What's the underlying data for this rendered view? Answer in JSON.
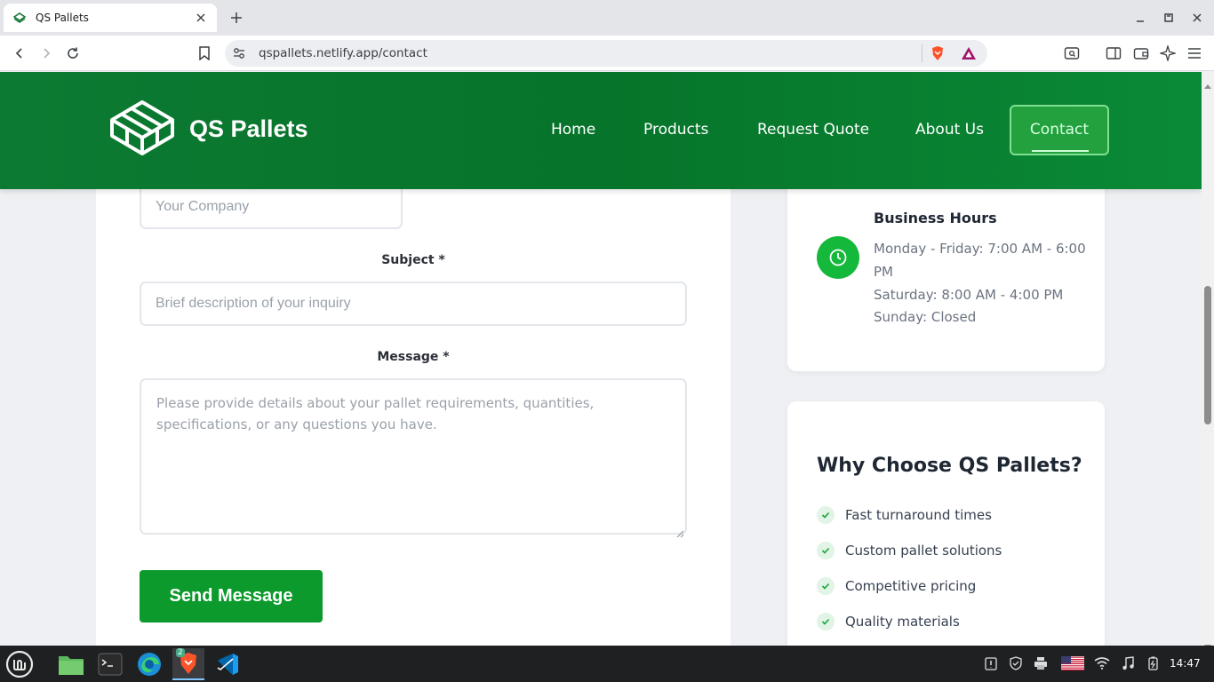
{
  "browser": {
    "tab_title": "QS Pallets",
    "url": "qspallets.netlify.app/contact"
  },
  "site": {
    "brand": "QS Pallets",
    "nav": [
      "Home",
      "Products",
      "Request Quote",
      "About Us"
    ],
    "nav_active": "Contact"
  },
  "form": {
    "company_placeholder": "Your Company",
    "subject_label": "Subject *",
    "subject_placeholder": "Brief description of your inquiry",
    "message_label": "Message *",
    "message_placeholder": "Please provide details about your pallet requirements, quantities, specifications, or any questions you have.",
    "submit_label": "Send Message"
  },
  "hours": {
    "title": "Business Hours",
    "lines": [
      "Monday - Friday: 7:00 AM - 6:00",
      "PM",
      "Saturday: 8:00 AM - 4:00 PM",
      "Sunday: Closed"
    ]
  },
  "why": {
    "title": "Why Choose QS Pallets?",
    "items": [
      "Fast turnaround times",
      "Custom pallet solutions",
      "Competitive pricing",
      "Quality materials"
    ]
  },
  "taskbar": {
    "clock": "14:47",
    "brave_badge": "2"
  },
  "colors": {
    "brand_green": "#0c7a32",
    "button_green": "#0c9a2c",
    "accent_green": "#14b83a"
  }
}
